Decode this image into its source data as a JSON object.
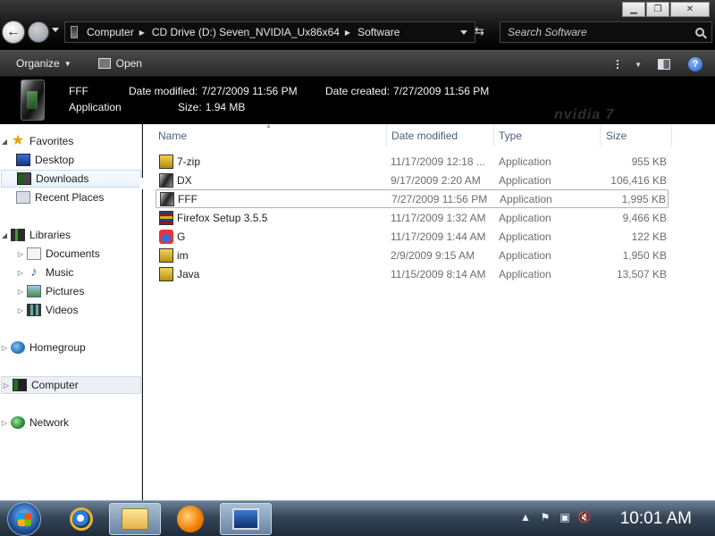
{
  "titlebar": {
    "breadcrumbs": [
      "Computer",
      "CD Drive (D:) Seven_NVIDIA_Ux86x64",
      "Software"
    ],
    "search_placeholder": "Search Software"
  },
  "commandbar": {
    "organize_label": "Organize",
    "open_label": "Open"
  },
  "details": {
    "file_name": "FFF",
    "file_type": "Application",
    "modified_label": "Date modified:",
    "modified_value": "7/27/2009 11:56 PM",
    "created_label": "Date created:",
    "created_value": "7/27/2009 11:56 PM",
    "size_label": "Size:",
    "size_value": "1.94 MB",
    "brand": "nvidia 7"
  },
  "navpane": {
    "favorites": "Favorites",
    "desktop": "Desktop",
    "downloads": "Downloads",
    "recent": "Recent Places",
    "libraries": "Libraries",
    "documents": "Documents",
    "music": "Music",
    "pictures": "Pictures",
    "videos": "Videos",
    "homegroup": "Homegroup",
    "computer": "Computer",
    "network": "Network"
  },
  "columns": {
    "name": "Name",
    "date": "Date modified",
    "type": "Type",
    "size": "Size"
  },
  "files": [
    {
      "name": "7-zip",
      "date": "11/17/2009 12:18 ...",
      "type": "Application",
      "size": "955 KB",
      "icon": "7zip-icon"
    },
    {
      "name": "DX",
      "date": "9/17/2009 2:20 AM",
      "type": "Application",
      "size": "106,416 KB",
      "icon": "directx-icon"
    },
    {
      "name": "FFF",
      "date": "7/27/2009 11:56 PM",
      "type": "Application",
      "size": "1,995 KB",
      "icon": "app-icon"
    },
    {
      "name": "Firefox Setup 3.5.5",
      "date": "11/17/2009 1:32 AM",
      "type": "Application",
      "size": "9,466 KB",
      "icon": "installer-icon"
    },
    {
      "name": "G",
      "date": "11/17/2009 1:44 AM",
      "type": "Application",
      "size": "122 KB",
      "icon": "setup-icon"
    },
    {
      "name": "im",
      "date": "2/9/2009 9:15 AM",
      "type": "Application",
      "size": "1,950 KB",
      "icon": "app-icon"
    },
    {
      "name": "Java",
      "date": "11/15/2009 8:14 AM",
      "type": "Application",
      "size": "13,507 KB",
      "icon": "app-icon"
    }
  ],
  "taskbar": {
    "clock": "10:01 AM"
  }
}
